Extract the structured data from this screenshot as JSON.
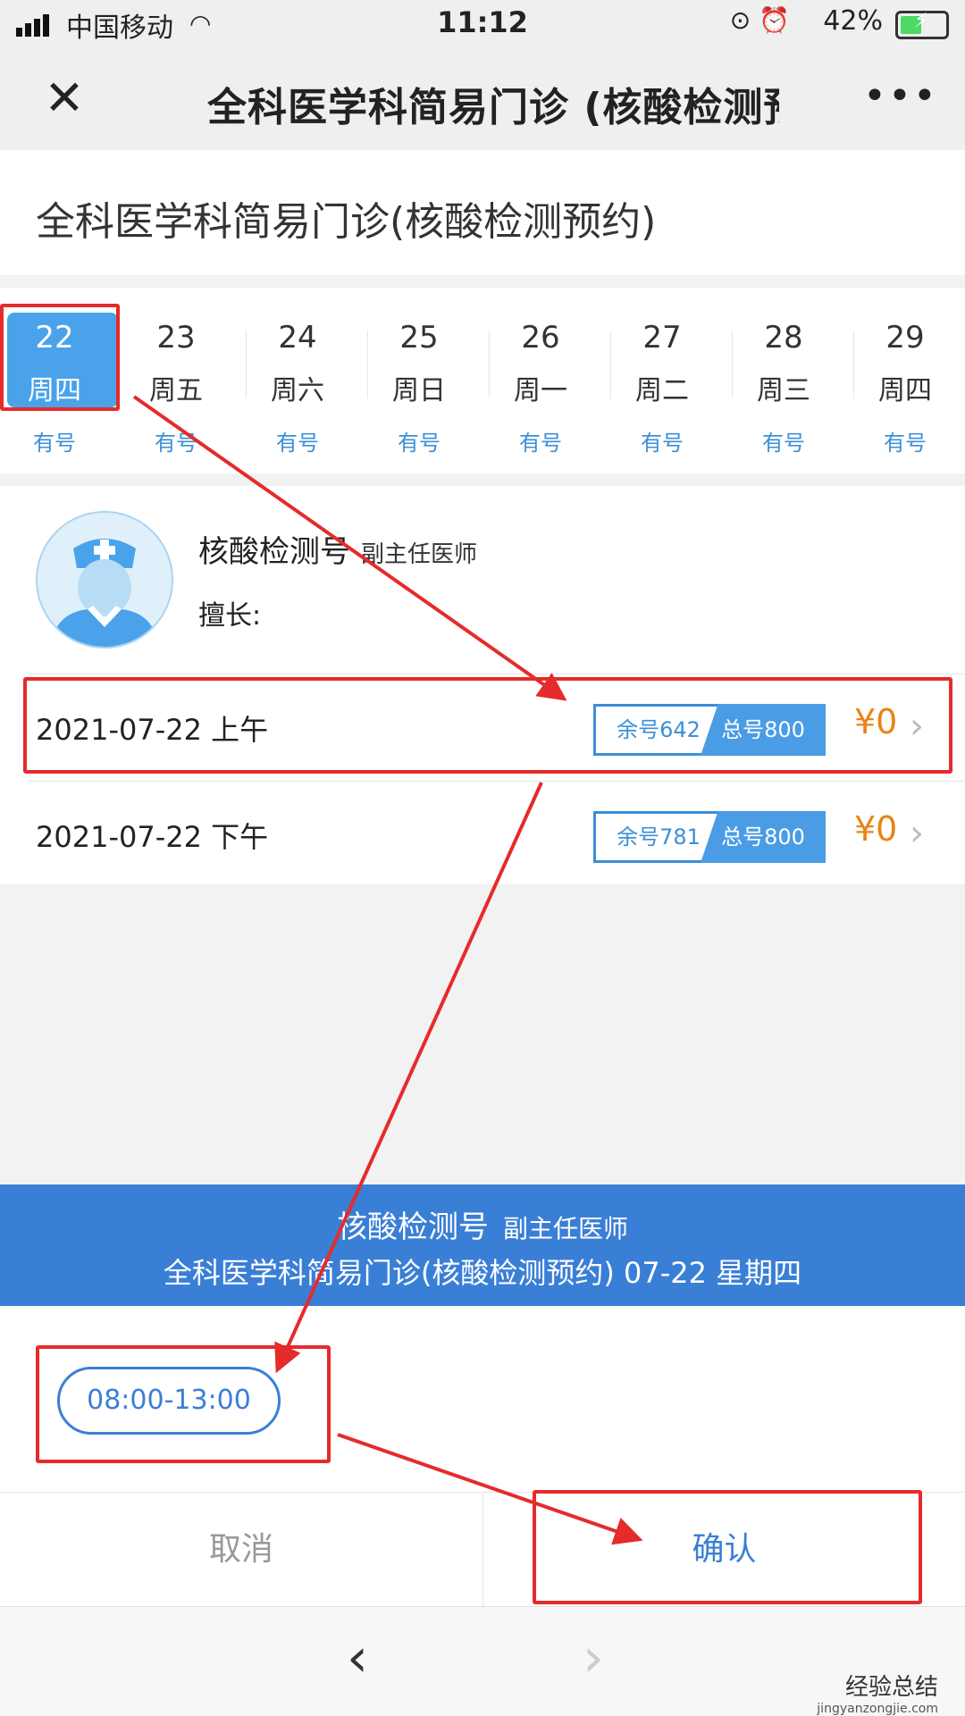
{
  "status": {
    "carrier": "中国移动",
    "time": "11:12",
    "battery": "42%"
  },
  "nav": {
    "title": "全科医学科简易门诊 (核酸检测预",
    "more": "•••"
  },
  "clinic": {
    "name": "全科医学科简易门诊(核酸检测预约)"
  },
  "dates": [
    {
      "day": "22",
      "week": "周四",
      "avail": "有号",
      "selected": true
    },
    {
      "day": "23",
      "week": "周五",
      "avail": "有号"
    },
    {
      "day": "24",
      "week": "周六",
      "avail": "有号"
    },
    {
      "day": "25",
      "week": "周日",
      "avail": "有号"
    },
    {
      "day": "26",
      "week": "周一",
      "avail": "有号"
    },
    {
      "day": "27",
      "week": "周二",
      "avail": "有号"
    },
    {
      "day": "28",
      "week": "周三",
      "avail": "有号"
    },
    {
      "day": "29",
      "week": "周四",
      "avail": "有号"
    }
  ],
  "doctor": {
    "name": "核酸检测号",
    "title": "副主任医师",
    "skill": "擅长:"
  },
  "slots": [
    {
      "date": "2021-07-22 上午",
      "remain": "余号642",
      "total": "总号800",
      "price": "¥0"
    },
    {
      "date": "2021-07-22 下午",
      "remain": "余号781",
      "total": "总号800",
      "price": "¥0"
    }
  ],
  "band": {
    "name": "核酸检测号",
    "title": "副主任医师",
    "line2": "全科医学科简易门诊(核酸检测预约)  07-22  星期四"
  },
  "time_slot": "08:00-13:00",
  "actions": {
    "cancel": "取消",
    "confirm": "确认"
  },
  "bottom": {
    "back": "‹",
    "forward": "›"
  },
  "watermark": {
    "text": "经验总结",
    "url": "jingyanzongjie.com"
  }
}
